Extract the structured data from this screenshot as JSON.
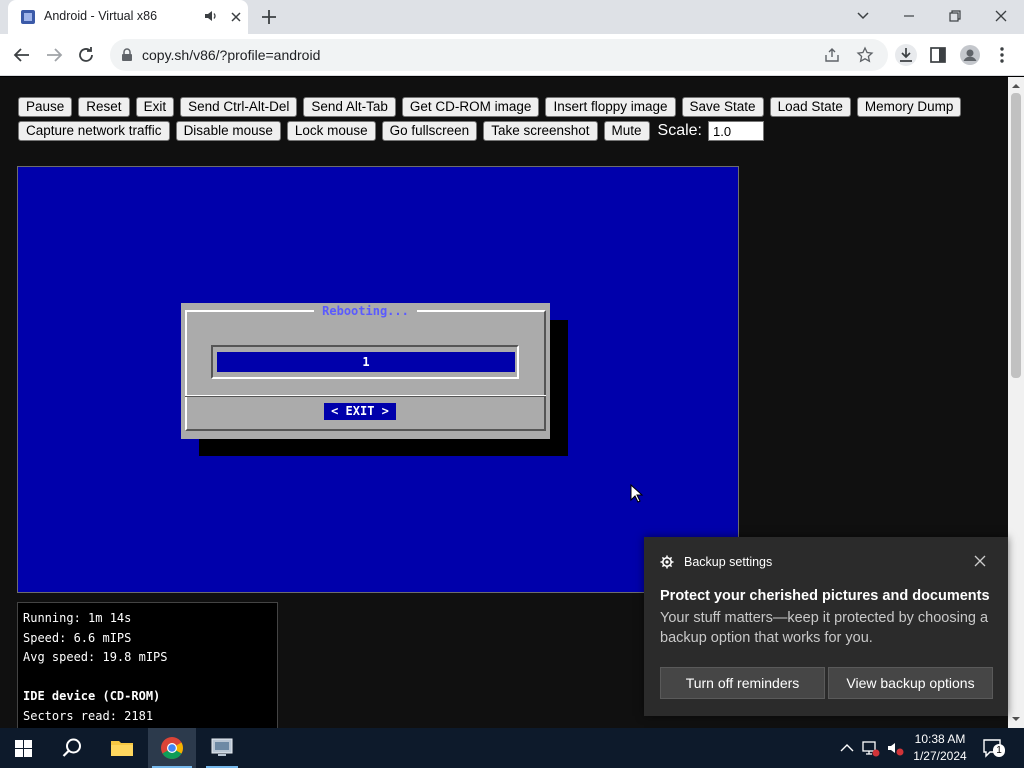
{
  "browser": {
    "tab_title": "Android - Virtual x86",
    "url": "copy.sh/v86/?profile=android"
  },
  "controls": {
    "row1": [
      "Pause",
      "Reset",
      "Exit",
      "Send Ctrl-Alt-Del",
      "Send Alt-Tab",
      "Get CD-ROM image",
      "Insert floppy image",
      "Save State",
      "Load State",
      "Memory Dump"
    ],
    "row2": [
      "Capture network traffic",
      "Disable mouse",
      "Lock mouse",
      "Go fullscreen",
      "Take screenshot",
      "Mute"
    ],
    "scale_label": "Scale:",
    "scale_value": "1.0"
  },
  "vm": {
    "dialog_title": "Rebooting...",
    "gauge_value": "1",
    "exit_button": "< EXIT >"
  },
  "stats": {
    "running": "Running: 1m 14s",
    "speed": "Speed: 6.6 mIPS",
    "avg_speed": "Avg speed: 19.8 mIPS",
    "ide_heading": "IDE device (CD-ROM)",
    "sectors_read": "Sectors read: 2181"
  },
  "toast": {
    "app_name": "Backup settings",
    "headline": "Protect your cherished pictures and documents",
    "body": "Your stuff matters—keep it protected by choosing a backup option that works for you.",
    "button_left": "Turn off reminders",
    "button_right": "View backup options"
  },
  "taskbar": {
    "time": "10:38 AM",
    "date": "1/27/2024",
    "notification_count": "1"
  },
  "colors": {
    "vm_blue": "#0000ab",
    "dialog_gray": "#ababab",
    "page_bg": "#101010",
    "taskbar_bg": "#0d1a2b"
  },
  "icons": [
    "v86-favicon-icon",
    "audio-playing-icon",
    "close-icon",
    "new-tab-icon",
    "back-icon",
    "forward-icon",
    "reload-icon",
    "lock-icon",
    "share-icon",
    "star-icon",
    "download-icon",
    "side-panel-icon",
    "profile-icon",
    "menu-icon",
    "gear-icon",
    "windows-start-icon",
    "search-icon",
    "file-explorer-icon",
    "chrome-icon"
  ]
}
